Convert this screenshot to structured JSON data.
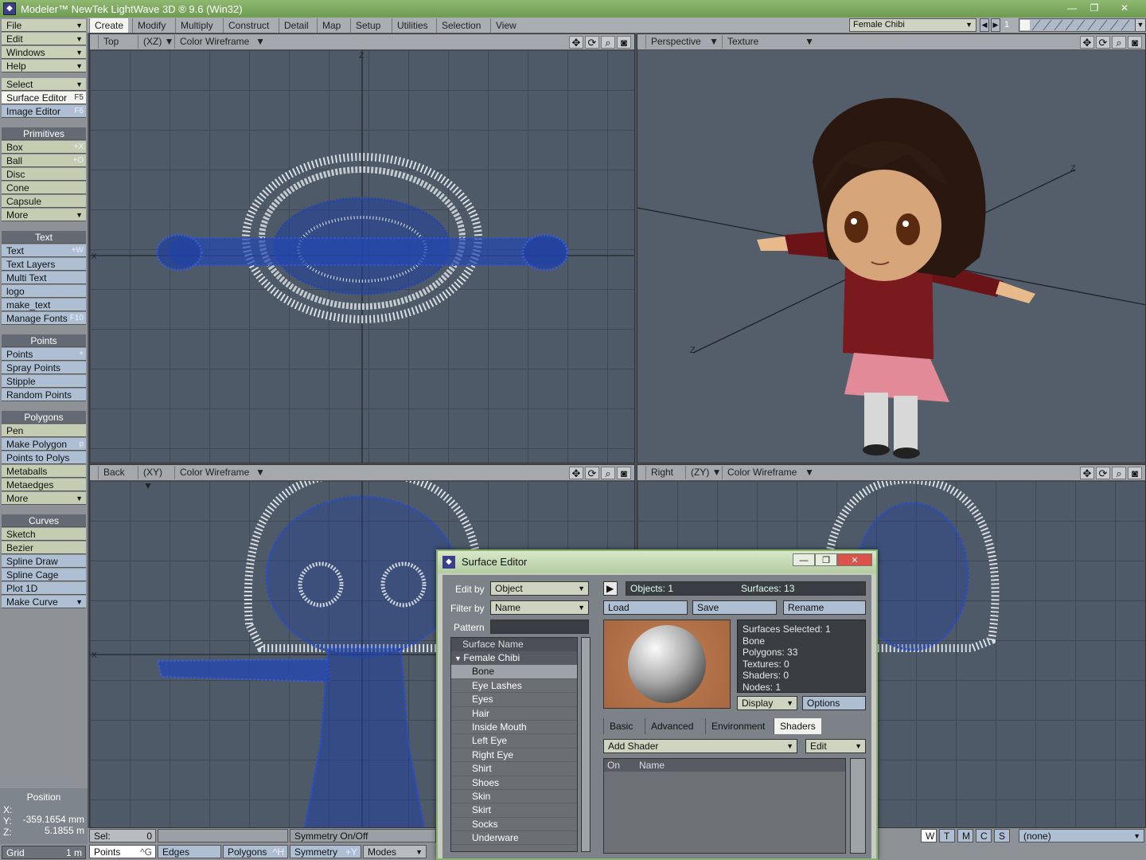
{
  "window": {
    "title": "Modeler™ NewTek LightWave 3D ® 9.6  (Win32)",
    "minimize": "—",
    "restore": "❐",
    "close": "✕"
  },
  "left_panel": {
    "menus": [
      {
        "label": "File",
        "arrow": "▼"
      },
      {
        "label": "Edit",
        "arrow": "▼"
      },
      {
        "label": "Windows",
        "arrow": "▼"
      },
      {
        "label": "Help",
        "arrow": "▼"
      }
    ],
    "select": {
      "label": "Select",
      "arrow": "▼"
    },
    "surface_editor": {
      "label": "Surface Editor",
      "shortcut": "F5"
    },
    "image_editor": {
      "label": "Image Editor",
      "shortcut": "F6"
    },
    "primitives": {
      "header": "Primitives",
      "items": [
        {
          "label": "Box",
          "shortcut": "+X"
        },
        {
          "label": "Ball",
          "shortcut": "+O"
        },
        {
          "label": "Disc",
          "shortcut": ""
        },
        {
          "label": "Cone",
          "shortcut": ""
        },
        {
          "label": "Capsule",
          "shortcut": ""
        },
        {
          "label": "More",
          "shortcut": "▼"
        }
      ]
    },
    "text": {
      "header": "Text",
      "items": [
        {
          "label": "Text",
          "shortcut": "+W"
        },
        {
          "label": "Text Layers",
          "shortcut": ""
        },
        {
          "label": "Multi Text",
          "shortcut": ""
        },
        {
          "label": "logo",
          "shortcut": ""
        },
        {
          "label": "make_text",
          "shortcut": ""
        },
        {
          "label": "Manage Fonts",
          "shortcut": "F10"
        }
      ]
    },
    "points": {
      "header": "Points",
      "items": [
        {
          "label": "Points",
          "shortcut": "+"
        },
        {
          "label": "Spray Points",
          "shortcut": ""
        },
        {
          "label": "Stipple",
          "shortcut": ""
        },
        {
          "label": "Random Points",
          "shortcut": ""
        }
      ]
    },
    "polygons": {
      "header": "Polygons",
      "items": [
        {
          "label": "Pen",
          "shortcut": ""
        },
        {
          "label": "Make Polygon",
          "shortcut": "p"
        },
        {
          "label": "Points to Polys",
          "shortcut": ""
        },
        {
          "label": "Metaballs",
          "shortcut": ""
        },
        {
          "label": "Metaedges",
          "shortcut": ""
        },
        {
          "label": "More",
          "shortcut": "▼"
        }
      ]
    },
    "curves": {
      "header": "Curves",
      "items": [
        {
          "label": "Sketch",
          "shortcut": ""
        },
        {
          "label": "Bezier",
          "shortcut": ""
        },
        {
          "label": "Spline Draw",
          "shortcut": ""
        },
        {
          "label": "Spline Cage",
          "shortcut": ""
        },
        {
          "label": "Plot 1D",
          "shortcut": ""
        },
        {
          "label": "Make Curve",
          "shortcut": "▼"
        }
      ]
    },
    "position": {
      "title": "Position",
      "x_label": "X:",
      "x": "-359.1654 mm",
      "y_label": "Y:",
      "y": "5.1855 m",
      "z_label": "Z:",
      "z": ""
    },
    "grid": {
      "label": "Grid",
      "value": "1 m"
    }
  },
  "top_tabs": [
    "Create",
    "Modify",
    "Multiply",
    "Construct",
    "Detail",
    "Map",
    "Setup",
    "Utilities",
    "Selection",
    "View"
  ],
  "object_select": "Female Chibi",
  "layer_number": "1",
  "viewports": {
    "top": {
      "view": "Top",
      "axis": "(XZ)",
      "mode": "Color Wireframe"
    },
    "perspective": {
      "view": "Perspective",
      "mode": "Texture"
    },
    "back": {
      "view": "Back",
      "axis": "(XY)",
      "mode": "Color Wireframe"
    },
    "right": {
      "view": "Right",
      "axis": "(ZY)",
      "mode": "Color Wireframe"
    }
  },
  "bottom_bar": {
    "sel_label": "Sel:",
    "sel_value": "0",
    "symmetry_status": "Symmetry On/Off",
    "points": "Points",
    "points_sc": "^G",
    "edges": "Edges",
    "polygons": "Polygons",
    "polygons_sc": "^H",
    "symmetry": "Symmetry",
    "symmetry_sc": "+Y",
    "modes": "Modes",
    "wtmcs": [
      "W",
      "T",
      "M",
      "C",
      "S"
    ],
    "vmap": "(none)"
  },
  "surface_editor": {
    "title": "Surface Editor",
    "edit_by_label": "Edit by",
    "edit_by": "Object",
    "filter_by_label": "Filter by",
    "filter_by": "Name",
    "pattern_label": "Pattern",
    "pattern": "",
    "list_header": "Surface Name",
    "group": "Female Chibi",
    "surfaces": [
      "Bone",
      "Eye Lashes",
      "Eyes",
      "Hair",
      "Inside Mouth",
      "Left Eye",
      "Right Eye",
      "Shirt",
      "Shoes",
      "Skin",
      "Skirt",
      "Socks",
      "Underware"
    ],
    "objects_count": "Objects: 1",
    "surfaces_count": "Surfaces: 13",
    "load": "Load",
    "save": "Save",
    "rename": "Rename",
    "info": [
      "Surfaces Selected: 1",
      "Bone",
      "Polygons: 33",
      "Textures: 0",
      "Shaders: 0",
      "Nodes: 1"
    ],
    "display": "Display",
    "options": "Options",
    "tabs": [
      "Basic",
      "Advanced",
      "Environment",
      "Shaders"
    ],
    "add_shader": "Add Shader",
    "edit": "Edit",
    "col_on": "On",
    "col_name": "Name"
  }
}
